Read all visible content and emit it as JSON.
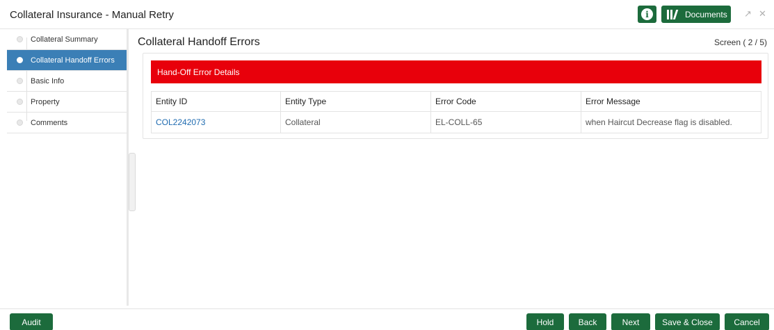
{
  "window": {
    "title": "Collateral Insurance - Manual Retry",
    "documents_label": "Documents"
  },
  "sidebar": {
    "items": [
      {
        "label": "Collateral Summary",
        "active": false
      },
      {
        "label": "Collateral Handoff Errors",
        "active": true
      },
      {
        "label": "Basic Info",
        "active": false
      },
      {
        "label": "Property",
        "active": false
      },
      {
        "label": "Comments",
        "active": false
      }
    ]
  },
  "main": {
    "title": "Collateral Handoff Errors",
    "screen_count": "Screen ( 2 / 5)",
    "panel_header": "Hand-Off Error Details",
    "columns": [
      "Entity ID",
      "Entity Type",
      "Error Code",
      "Error Message"
    ],
    "rows": [
      [
        "COL2242073",
        "Collateral",
        "EL-COLL-65",
        "when Haircut Decrease flag is disabled."
      ]
    ]
  },
  "footer": {
    "audit": "Audit",
    "hold": "Hold",
    "back": "Back",
    "next": "Next",
    "save_close": "Save & Close",
    "cancel": "Cancel"
  },
  "colors": {
    "primary_button": "#1c6b3c",
    "active_step": "#3b7fb6",
    "error_header": "#e8000b",
    "link": "#1f6bb0"
  }
}
